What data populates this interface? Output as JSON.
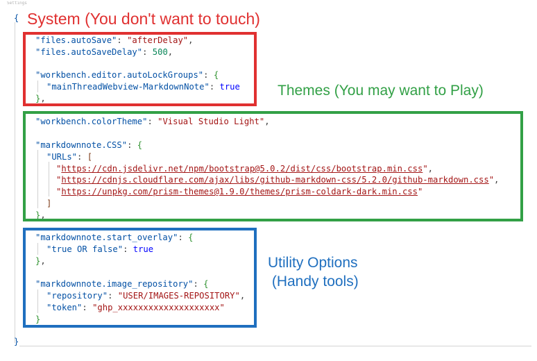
{
  "tab_label": "Settings",
  "braces": {
    "open": "{",
    "close": "}"
  },
  "colors": {
    "red_box": "#e03030",
    "green_box": "#32a046",
    "blue_box": "#1f6fbf"
  },
  "annotations": {
    "system": "System (You don't want to touch)",
    "themes": "Themes (You may want to Play)",
    "utility_line1": "Utility Options",
    "utility_line2": " (Handy tools)"
  },
  "code": {
    "files_autosave_key": "\"files.autoSave\"",
    "files_autosave_val": "\"afterDelay\"",
    "files_autosavedelay_key": "\"files.autoSaveDelay\"",
    "files_autosavedelay_val": "500",
    "autolock_key": "\"workbench.editor.autoLockGroups\"",
    "autolock_inner_key": "\"mainThreadWebview-MarkdownNote\"",
    "autolock_inner_val": "true",
    "colortheme_key": "\"workbench.colorTheme\"",
    "colortheme_val": "\"Visual Studio Light\"",
    "css_key": "\"markdownnote.CSS\"",
    "urls_key": "\"URLs\"",
    "url1": "https://cdn.jsdelivr.net/npm/bootstrap@5.0.2/dist/css/bootstrap.min.css",
    "url2": "https://cdnjs.cloudflare.com/ajax/libs/github-markdown-css/5.2.0/github-markdown.css",
    "url3": "https://unpkg.com/prism-themes@1.9.0/themes/prism-coldark-dark.min.css",
    "overlay_key": "\"markdownnote.start_overlay\"",
    "overlay_inner_key": "\"true OR false\"",
    "overlay_inner_val": "true",
    "repo_key": "\"markdownnote.image_repository\"",
    "repository_key": "\"repository\"",
    "repository_val": "\"USER/IMAGES-REPOSITORY\"",
    "token_key": "\"token\"",
    "token_val": "\"ghp_xxxxxxxxxxxxxxxxxxxx\""
  }
}
